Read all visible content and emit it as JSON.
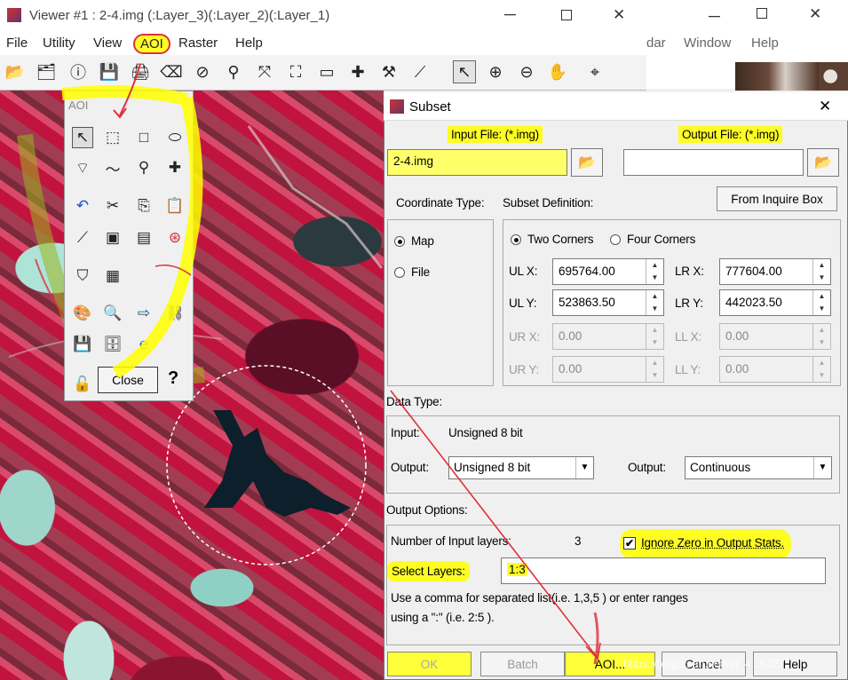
{
  "viewer": {
    "title": "Viewer #1 : 2-4.img (:Layer_3)(:Layer_2)(:Layer_1)",
    "menu": [
      "File",
      "Utility",
      "View",
      "AOI",
      "Raster",
      "Help"
    ]
  },
  "background_window": {
    "menu": [
      "dar",
      "Window",
      "Help"
    ]
  },
  "aoi_palette": {
    "title": "AOI",
    "close_label": "Close",
    "help_glyph": "?"
  },
  "subset": {
    "title": "Subset",
    "input_file_label": "Input File: (*.img)",
    "input_file_value": "2-4.img",
    "output_file_label": "Output File: (*.img)",
    "output_file_value": "",
    "coordinate_type_label": "Coordinate Type:",
    "coord_options": [
      "Map",
      "File"
    ],
    "subset_definition_label": "Subset Definition:",
    "from_inquire_label": "From Inquire Box",
    "corner_options": [
      "Two Corners",
      "Four Corners"
    ],
    "ulx_label": "UL X:",
    "ulx": "695764.00",
    "lrx_label": "LR X:",
    "lrx": "777604.00",
    "uly_label": "UL Y:",
    "uly": "523863.50",
    "lry_label": "LR Y:",
    "lry": "442023.50",
    "urx_label": "UR X:",
    "urx": "0.00",
    "llx_label": "LL X:",
    "llx": "0.00",
    "ury_label": "UR Y:",
    "ury": "0.00",
    "lly_label": "LL Y:",
    "lly": "0.00",
    "data_type_label": "Data Type:",
    "input_label": "Input:",
    "input_type": "Unsigned 8 bit",
    "output_label": "Output:",
    "output_type": "Unsigned 8 bit",
    "output2_label": "Output:",
    "output_mode": "Continuous",
    "output_options_label": "Output Options:",
    "num_layers_label": "Number of Input layers:",
    "num_layers": "3",
    "ignore_zero_label": "Ignore Zero in Output Stats.",
    "select_layers_label": "Select Layers:",
    "select_layers_value": "1:3",
    "hint_line1": "Use a comma for separated list(i.e. 1,3,5 ) or enter ranges",
    "hint_line2": "using a \":\" (i.e. 2:5 ).",
    "buttons": {
      "ok": "OK",
      "batch": "Batch",
      "aoi": "AOI...",
      "cancel": "Cancel",
      "help": "Help"
    },
    "watermark": "https://blog.csdn.net/qq_4...6127"
  },
  "colors": {
    "highlight": "#ffff00",
    "annotation_red": "#e0303a"
  }
}
